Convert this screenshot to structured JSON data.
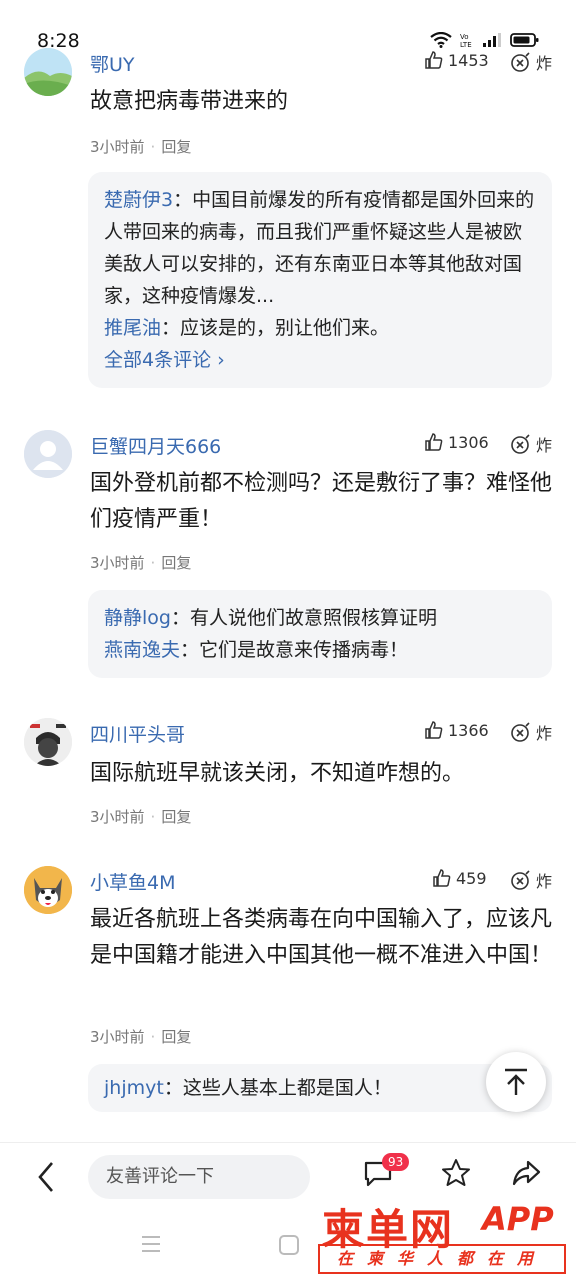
{
  "status": {
    "time": "8:28"
  },
  "comments": [
    {
      "name": "鄂UY",
      "likes": "1453",
      "bomb": "炸",
      "text": "故意把病毒带进来的",
      "time": "3小时前",
      "reply": "回复",
      "replies": [
        {
          "name": "楚蔚伊3",
          "text": "：中国目前爆发的所有疫情都是国外回来的人带回来的病毒，而且我们严重怀疑这些人是被欧美敌人可以安排的，还有东南亚日本等其他敌对国家，这种疫情爆发..."
        },
        {
          "name": "推尾油",
          "text": "：应该是的，别让他们来。"
        }
      ],
      "more": "全部4条评论 ›"
    },
    {
      "name": "巨蟹四月天666",
      "likes": "1306",
      "bomb": "炸",
      "text": "国外登机前都不检测吗？还是敷衍了事？难怪他们疫情严重！",
      "time": "3小时前",
      "reply": "回复",
      "replies": [
        {
          "name": "静静log",
          "text": "：有人说他们故意照假核算证明"
        },
        {
          "name": "燕南逸夫",
          "text": "：它们是故意来传播病毒！"
        }
      ]
    },
    {
      "name": "四川平头哥",
      "likes": "1366",
      "bomb": "炸",
      "text": "国际航班早就该关闭，不知道咋想的。",
      "time": "3小时前",
      "reply": "回复"
    },
    {
      "name": "小草鱼4M",
      "likes": "459",
      "bomb": "炸",
      "text": "最近各航班上各类病毒在向中国输入了，应该凡是中国籍才能进入中国其他一概不准进入中国！",
      "time": "3小时前",
      "reply": "回复",
      "replies": [
        {
          "name": "jhjmyt",
          "text": "：这些人基本上都是国人！"
        }
      ]
    }
  ],
  "bottom": {
    "placeholder": "友善评论一下",
    "badge": "93"
  },
  "watermark": {
    "big": "柬单网",
    "app": "APP",
    "sub": "在柬华人都在用"
  },
  "colors": {
    "link": "#3a6ab0",
    "accent": "#e8321e",
    "badge": "#f0304a"
  }
}
